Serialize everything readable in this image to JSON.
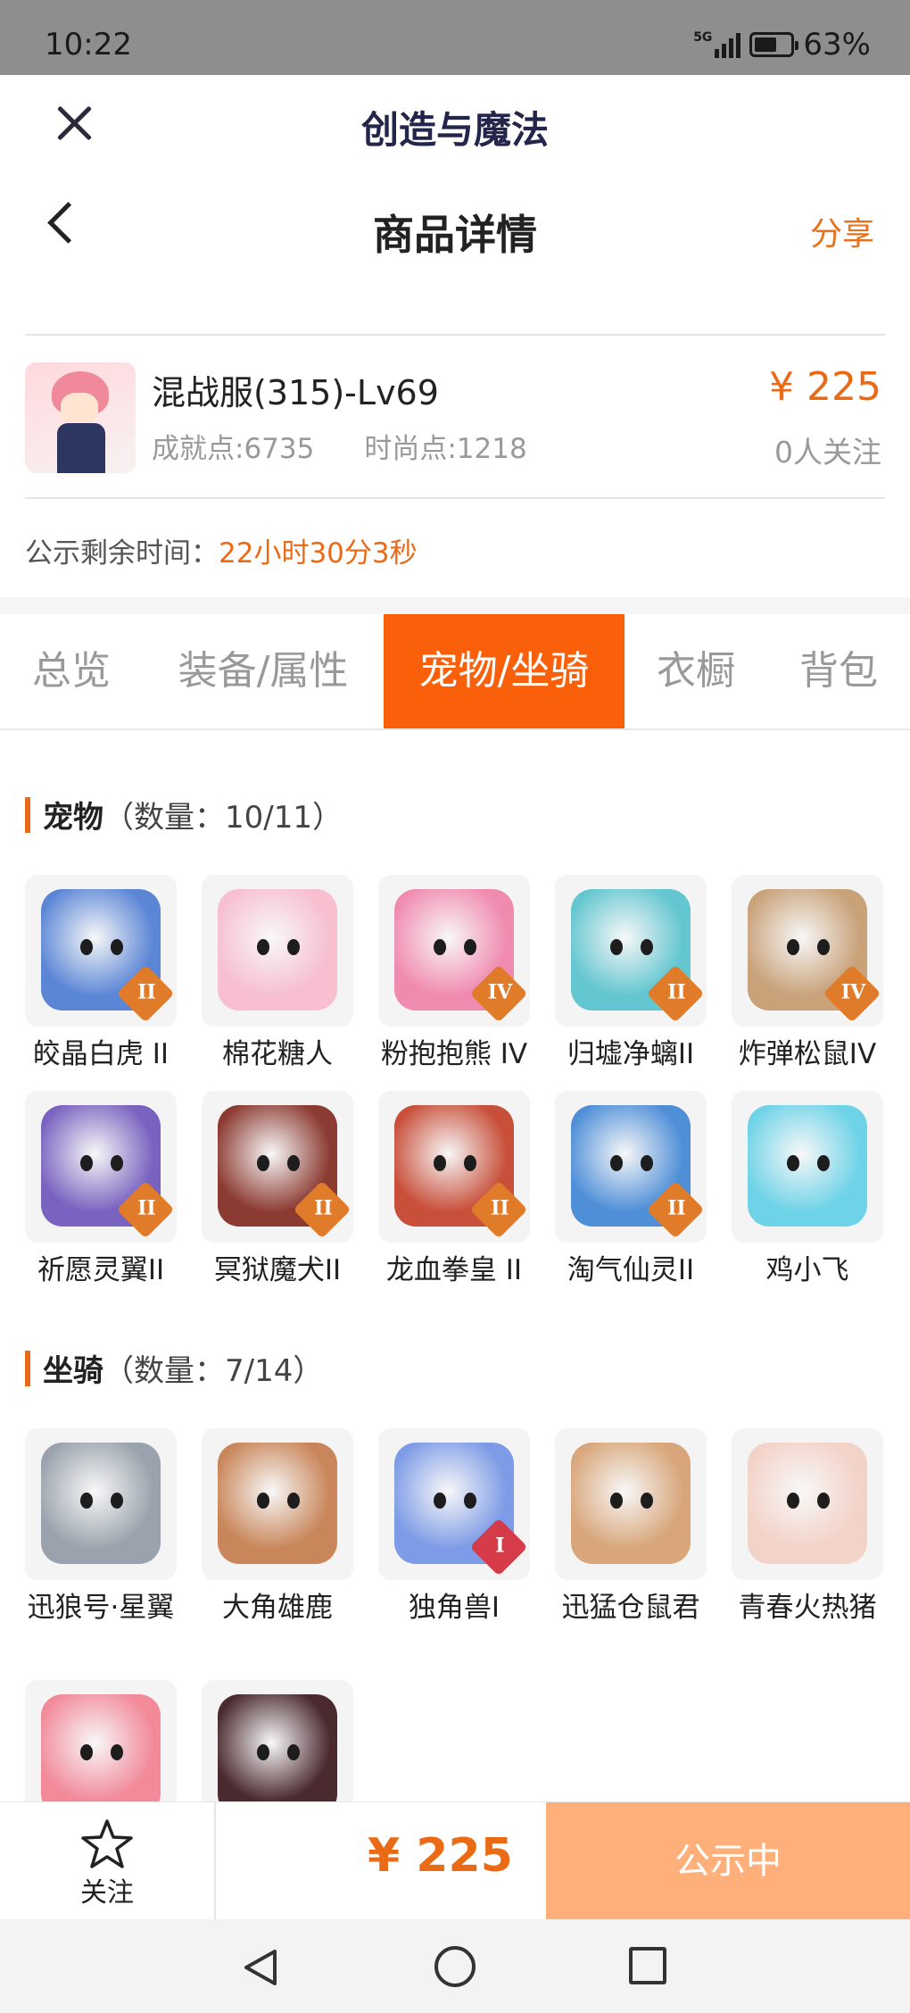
{
  "status_bar": {
    "time": "10:22",
    "network": "5G",
    "battery": "63%",
    "battery_level": 0.63
  },
  "app": {
    "title": "创造与魔法"
  },
  "nav": {
    "title": "商品详情",
    "share": "分享"
  },
  "product": {
    "name": "混战服(315)-Lv69",
    "achievement": "成就点:6735",
    "fashion": "时尚点:1218",
    "price": "¥ 225",
    "followers": "0人关注",
    "timer_label": "公示剩余时间：",
    "timer_value": "22小时30分3秒"
  },
  "tabs": [
    {
      "label": "总览",
      "active": false
    },
    {
      "label": "装备/属性",
      "active": false
    },
    {
      "label": "宠物/坐骑",
      "active": true
    },
    {
      "label": "衣橱",
      "active": false
    },
    {
      "label": "背包",
      "active": false
    }
  ],
  "pets": {
    "title": "宠物",
    "count": "（数量：10/11）",
    "items": [
      {
        "label": "皎晶白虎 II",
        "badge": "II",
        "color": "#5b86d6"
      },
      {
        "label": "棉花糖人",
        "badge": "",
        "color": "#f7bfd0"
      },
      {
        "label": "粉抱抱熊 IV",
        "badge": "IV",
        "color": "#f08bb0"
      },
      {
        "label": "归墟净螭II",
        "badge": "II",
        "color": "#63c6d0"
      },
      {
        "label": "炸弹松鼠IV",
        "badge": "IV",
        "color": "#c9a27a"
      },
      {
        "label": "祈愿灵翼II",
        "badge": "II",
        "color": "#7a63c0"
      },
      {
        "label": "冥狱魔犬II",
        "badge": "II",
        "color": "#8c3b32"
      },
      {
        "label": "龙血拳皇 II",
        "badge": "II",
        "color": "#c8503b"
      },
      {
        "label": "淘气仙灵II",
        "badge": "II",
        "color": "#4f8fd8"
      },
      {
        "label": "鸡小飞",
        "badge": "",
        "color": "#6fd3e8"
      }
    ]
  },
  "mounts": {
    "title": "坐骑",
    "count": "（数量：7/14）",
    "items": [
      {
        "label": "迅狼号·星翼",
        "badge": "",
        "color": "#9aa3ad"
      },
      {
        "label": "大角雄鹿",
        "badge": "",
        "color": "#c9865a"
      },
      {
        "label": "独角兽I",
        "badge": "I",
        "color": "#7d9be6"
      },
      {
        "label": "迅猛仓鼠君",
        "badge": "",
        "color": "#d8a67a"
      },
      {
        "label": "青春火热猪",
        "badge": "",
        "color": "#f3d2c8"
      },
      {
        "label": "",
        "badge": "",
        "color": "#f28a9a"
      },
      {
        "label": "",
        "badge": "",
        "color": "#4a2a2f"
      }
    ]
  },
  "bottom": {
    "follow": "关注",
    "price": "¥ 225",
    "status": "公示中"
  },
  "colors": {
    "accent": "#fa5f0a",
    "price": "#ea6a16",
    "status_button": "#ffb07a",
    "badge": "#e07b2a"
  }
}
